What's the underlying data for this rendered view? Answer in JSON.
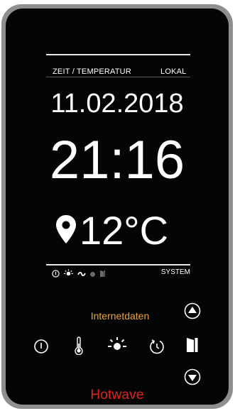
{
  "header": {
    "left_label": "ZEIT / TEMPERATUR",
    "right_label": "LOKAL"
  },
  "display": {
    "date": "11.02.2018",
    "time": "21:16",
    "temperature": "12°C"
  },
  "status_bar": {
    "icons": [
      "power-icon",
      "light-icon",
      "wave-icon",
      "dot-icon",
      "door-icon"
    ],
    "label": "SYSTEM"
  },
  "info": {
    "text": "Internetdaten"
  },
  "controls": {
    "buttons": [
      "power-button",
      "temperature-button",
      "light-button",
      "timer-button",
      "door-button",
      "up-button",
      "down-button"
    ]
  },
  "brand": {
    "name": "Hotwave",
    "color": "#e0231d"
  },
  "colors": {
    "screen": "#050505",
    "bezel": "#8f8f8f",
    "accent_info": "#e8a43a"
  }
}
